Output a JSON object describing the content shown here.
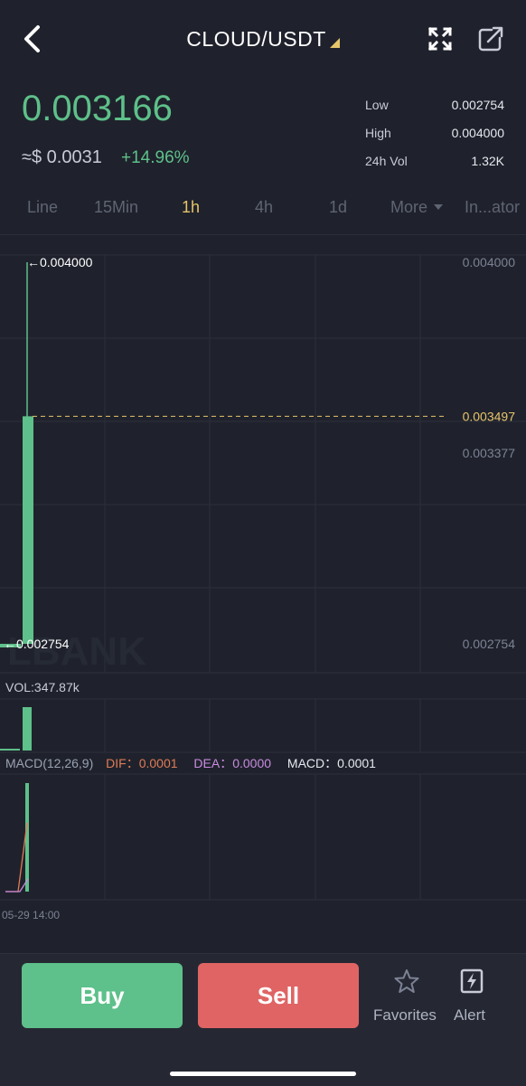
{
  "header": {
    "title": "CLOUD/USDT",
    "icons": [
      "back-icon",
      "expand-icon",
      "share-icon"
    ]
  },
  "price": {
    "last": "0.003166",
    "usd": "≈$ 0.0031",
    "change": "+14.96%"
  },
  "stats": [
    {
      "label": "Low",
      "value": "0.002754"
    },
    {
      "label": "High",
      "value": "0.004000"
    },
    {
      "label": "24h Vol",
      "value": "1.32K"
    }
  ],
  "tabs": [
    "Line",
    "15Min",
    "1h",
    "4h",
    "1d",
    "More",
    "In...ator"
  ],
  "active_tab": "1h",
  "colors": {
    "up": "#5ec08a",
    "down": "#e06464",
    "accent": "#e6c46a",
    "background": "#1f222c",
    "dif": "#e07b55",
    "dea": "#c98be0"
  },
  "chart_data": {
    "type": "candlestick",
    "axis_labels": [
      "0.004000",
      "0.003377",
      "0.002754"
    ],
    "ylim": [
      0.002754,
      0.004
    ],
    "candles": [
      {
        "open": 0.002754,
        "close": 0.002754,
        "high": 0.002754,
        "low": 0.002754
      },
      {
        "open": 0.002754,
        "close": 0.003497,
        "high": 0.004,
        "low": 0.002754
      }
    ],
    "high_marker": "←0.004000",
    "low_marker": "←0.002754",
    "current_price_line": "0.003497",
    "volume": {
      "label": "VOL:347.87k",
      "values": [
        0.03,
        1.0
      ]
    },
    "macd": {
      "label": "MACD(12,26,9)",
      "dif": "DIF：0.0001",
      "dea": "DEA：0.0000",
      "macd": "MACD：0.0001"
    },
    "time_label": "05-29 14:00",
    "watermark": "LBANK"
  },
  "actions": {
    "buy": "Buy",
    "sell": "Sell",
    "favorites": "Favorites",
    "alert": "Alert"
  }
}
